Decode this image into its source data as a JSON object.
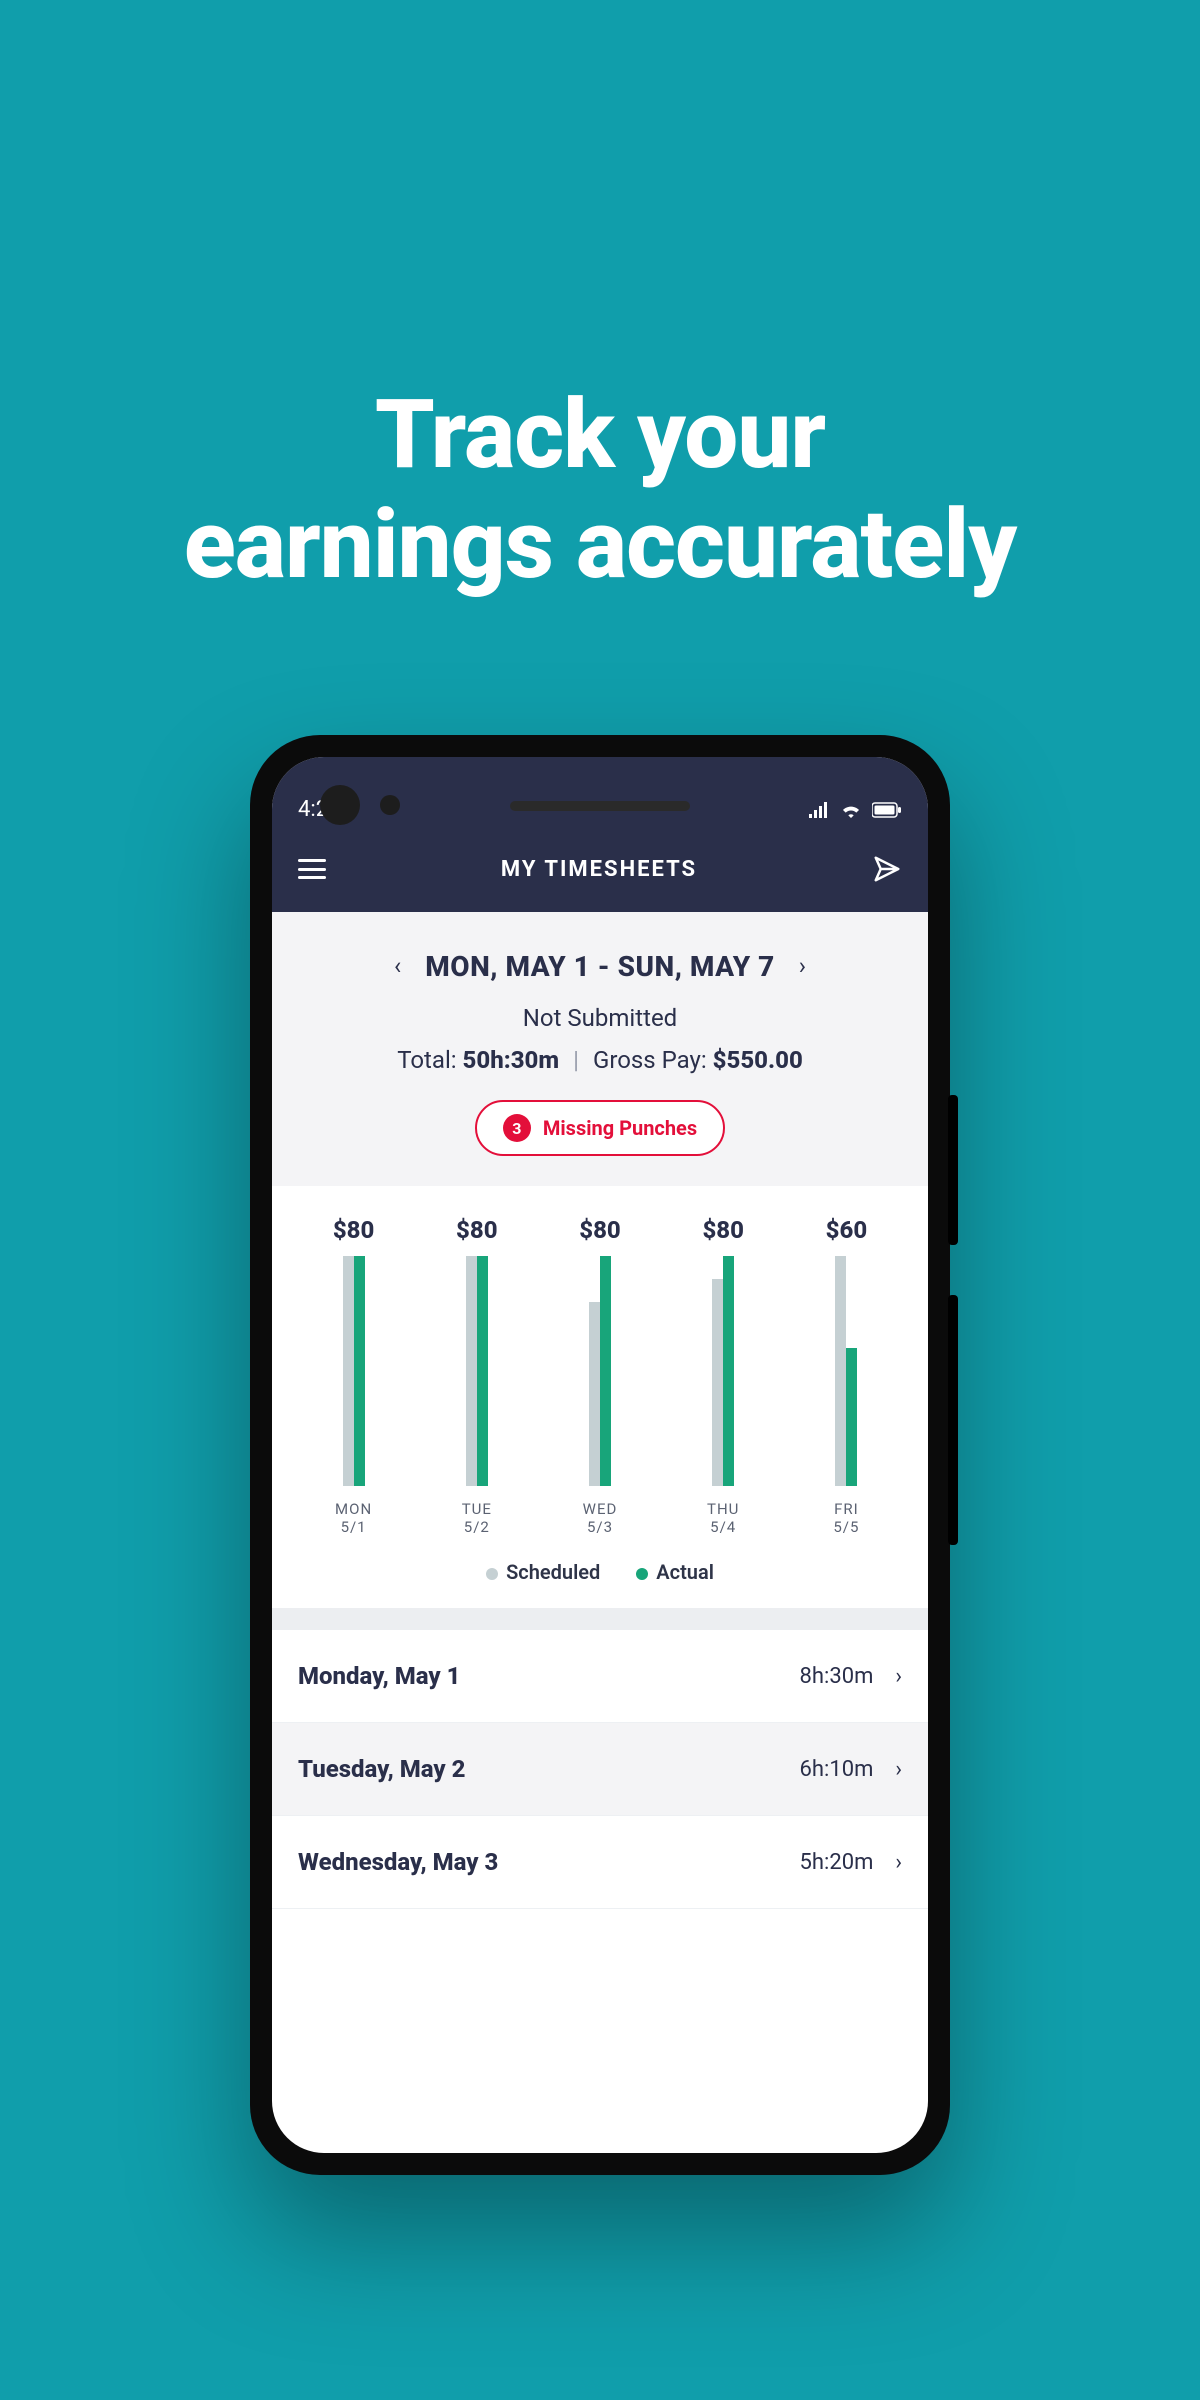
{
  "headline": "Track your\nearnings accurately",
  "statusbar": {
    "time": "4:20"
  },
  "appbar": {
    "title": "MY TIMESHEETS"
  },
  "summary": {
    "date_range": "MON, MAY 1 - SUN, MAY 7",
    "status": "Not Submitted",
    "total_label": "Total:",
    "total_value": "50h:30m",
    "gross_label": "Gross Pay:",
    "gross_value": "$550.00",
    "missing": {
      "count": "3",
      "label": "Missing Punches"
    }
  },
  "legend": {
    "scheduled": "Scheduled",
    "actual": "Actual"
  },
  "rows": [
    {
      "name": "Monday, May  1",
      "duration": "8h:30m"
    },
    {
      "name": "Tuesday, May  2",
      "duration": "6h:10m"
    },
    {
      "name": "Wednesday, May  3",
      "duration": "5h:20m"
    }
  ],
  "chart_data": {
    "type": "bar",
    "categories": [
      "MON 5/1",
      "TUE 5/2",
      "WED 5/3",
      "THU 5/4",
      "FRI 5/5"
    ],
    "value_labels": [
      "$80",
      "$80",
      "$80",
      "$80",
      "$60"
    ],
    "series": [
      {
        "name": "Scheduled",
        "values": [
          100,
          100,
          80,
          90,
          100
        ]
      },
      {
        "name": "Actual",
        "values": [
          100,
          100,
          100,
          100,
          60
        ]
      }
    ],
    "ylim": [
      0,
      100
    ],
    "legend": [
      "Scheduled",
      "Actual"
    ],
    "day_labels": [
      {
        "dow": "MON",
        "date": "5/1"
      },
      {
        "dow": "TUE",
        "date": "5/2"
      },
      {
        "dow": "WED",
        "date": "5/3"
      },
      {
        "dow": "THU",
        "date": "5/4"
      },
      {
        "dow": "FRI",
        "date": "5/5"
      }
    ]
  }
}
